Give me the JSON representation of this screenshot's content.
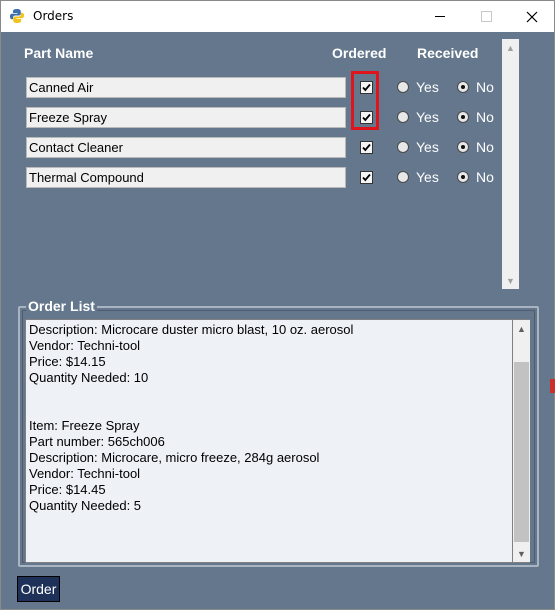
{
  "window": {
    "title": "Orders",
    "controls": {
      "minimize": "—",
      "maximize": "☐",
      "close": "✕"
    }
  },
  "table": {
    "headers": {
      "part": "Part Name",
      "ordered": "Ordered",
      "received": "Received"
    },
    "yes_label": "Yes",
    "no_label": "No",
    "rows": [
      {
        "part": "Canned Air",
        "ordered": true,
        "received": "No"
      },
      {
        "part": "Freeze Spray",
        "ordered": true,
        "received": "No"
      },
      {
        "part": "Contact Cleaner",
        "ordered": true,
        "received": "No"
      },
      {
        "part": "Thermal Compound",
        "ordered": true,
        "received": "No"
      }
    ]
  },
  "order_list": {
    "title": "Order List",
    "lines": [
      "Description: Microcare duster micro blast, 10 oz. aerosol",
      "Vendor: Techni-tool",
      "Price: $14.15",
      "Quantity Needed: 10",
      "",
      "",
      "Item: Freeze Spray",
      "Part number: 565ch006",
      "Description: Microcare, micro freeze, 284g aerosol",
      "Vendor: Techni-tool",
      "Price: $14.45",
      "Quantity Needed: 5"
    ]
  },
  "order_button": "Order",
  "colors": {
    "background": "#64778d",
    "highlight": "#e0151b",
    "button": "#1e3259"
  }
}
